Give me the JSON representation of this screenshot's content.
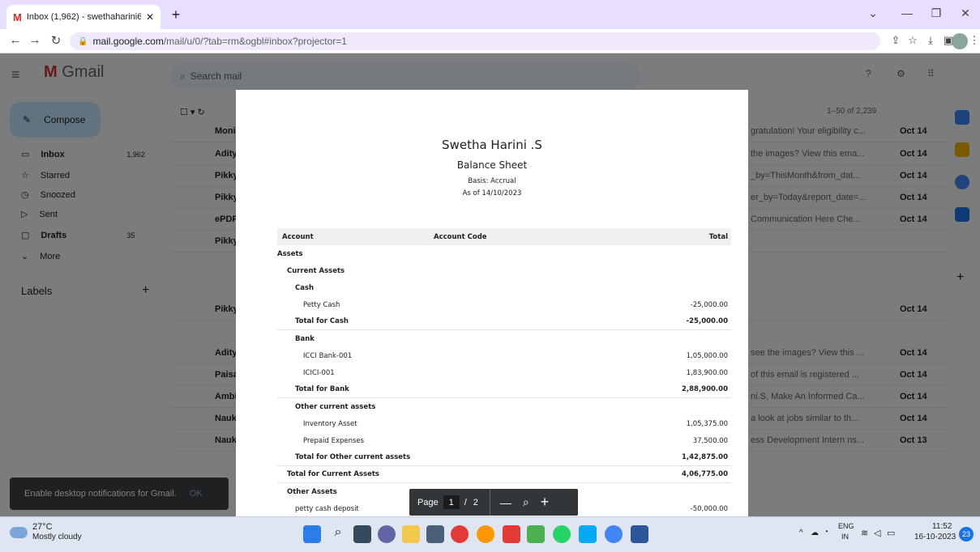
{
  "browser": {
    "tab_title": "Inbox (1,962) - swethaharini60\u0000",
    "url_host": "mail.google.com",
    "url_path": "/mail/u/0/?tab=rm&ogbl#inbox?projector=1"
  },
  "gmail": {
    "search_placeholder": "Search mail",
    "compose_label": "Compose",
    "sidebar": [
      {
        "label": "Inbox",
        "count": "1,962"
      },
      {
        "label": "Starred",
        "count": ""
      },
      {
        "label": "Snoozed",
        "count": ""
      },
      {
        "label": "Sent",
        "count": ""
      },
      {
        "label": "Drafts",
        "count": "35"
      },
      {
        "label": "More",
        "count": ""
      }
    ],
    "labels_heading": "Labels",
    "range": "1–50 of 2,239",
    "rows": [
      {
        "sender": "Moni",
        "snippet": "gratulation! Your eligibility c...",
        "date": "Oct 14"
      },
      {
        "sender": "Adity",
        "snippet": "the images? View this ema...",
        "date": "Oct 14"
      },
      {
        "sender": "Pikky",
        "snippet": "_by=ThisMonth&from_dat...",
        "date": "Oct 14"
      },
      {
        "sender": "Pikky",
        "snippet": "er_by=Today&report_date=...",
        "date": "Oct 14"
      },
      {
        "sender": "ePDF",
        "snippet": "Communication Here Che...",
        "date": "Oct 14"
      },
      {
        "sender": "Pikky",
        "snippet": "",
        "date": ""
      },
      {
        "sender": "Pikky",
        "snippet": "",
        "date": "Oct 14"
      },
      {
        "sender": "Adity",
        "snippet": "see the images? View this ...",
        "date": "Oct 14"
      },
      {
        "sender": "Paisa",
        "snippet": "of this email is registered ...",
        "date": "Oct 14"
      },
      {
        "sender": "Ambi",
        "snippet": "ni.S, Make An Informed Ca...",
        "date": "Oct 14"
      },
      {
        "sender": "Nauk",
        "snippet": "a look at jobs similar to th...",
        "date": "Oct 14"
      },
      {
        "sender": "Nauk",
        "snippet": "ess Development Intern ns...",
        "date": "Oct 13"
      }
    ],
    "notif_text": "Enable desktop notifications for Gmail.",
    "notif_ok": "OK"
  },
  "report": {
    "org": "Swetha Harini .S",
    "title": "Balance Sheet",
    "basis": "Basis: Accrual",
    "as_of": "As of 14/10/2023",
    "col_account": "Account",
    "col_code": "Account Code",
    "col_total": "Total",
    "rows": [
      {
        "label": "Assets",
        "amount": "",
        "indent": 0,
        "style": "hd"
      },
      {
        "label": "Current Assets",
        "amount": "",
        "indent": 1,
        "style": "hd"
      },
      {
        "label": "Cash",
        "amount": "",
        "indent": 2,
        "style": "hd"
      },
      {
        "label": "Petty Cash",
        "amount": "-25,000.00",
        "indent": 3,
        "style": ""
      },
      {
        "label": "Total for Cash",
        "amount": "-25,000.00",
        "indent": 2,
        "style": "tot"
      },
      {
        "label": "Bank",
        "amount": "",
        "indent": 2,
        "style": "hd"
      },
      {
        "label": "ICCI Bank-001",
        "amount": "1,05,000.00",
        "indent": 3,
        "style": ""
      },
      {
        "label": "ICICI-001",
        "amount": "1,83,900.00",
        "indent": 3,
        "style": ""
      },
      {
        "label": "Total for Bank",
        "amount": "2,88,900.00",
        "indent": 2,
        "style": "tot"
      },
      {
        "label": "Other current assets",
        "amount": "",
        "indent": 2,
        "style": "hd"
      },
      {
        "label": "Inventory Asset",
        "amount": "1,05,375.00",
        "indent": 3,
        "style": ""
      },
      {
        "label": "Prepaid Expenses",
        "amount": "37,500.00",
        "indent": 3,
        "style": ""
      },
      {
        "label": "Total for Other current assets",
        "amount": "1,42,875.00",
        "indent": 2,
        "style": "tot"
      },
      {
        "label": "Total for Current Assets",
        "amount": "4,06,775.00",
        "indent": 1,
        "style": "tot"
      },
      {
        "label": "Other Assets",
        "amount": "",
        "indent": 1,
        "style": "hd"
      },
      {
        "label": "petty cash deposit",
        "amount": "-50,000.00",
        "indent": 2,
        "style": ""
      }
    ]
  },
  "pdf_toolbar": {
    "page_label": "Page",
    "current_page": "1",
    "sep": "/",
    "total_pages": "2",
    "zoom_out": "—",
    "zoom_in": "+"
  },
  "taskbar": {
    "temp": "27°C",
    "weather": "Mostly cloudy",
    "lang_top": "ENG",
    "lang_bottom": "IN",
    "time": "11:52",
    "date": "16-10-2023",
    "notif_count": "23"
  }
}
